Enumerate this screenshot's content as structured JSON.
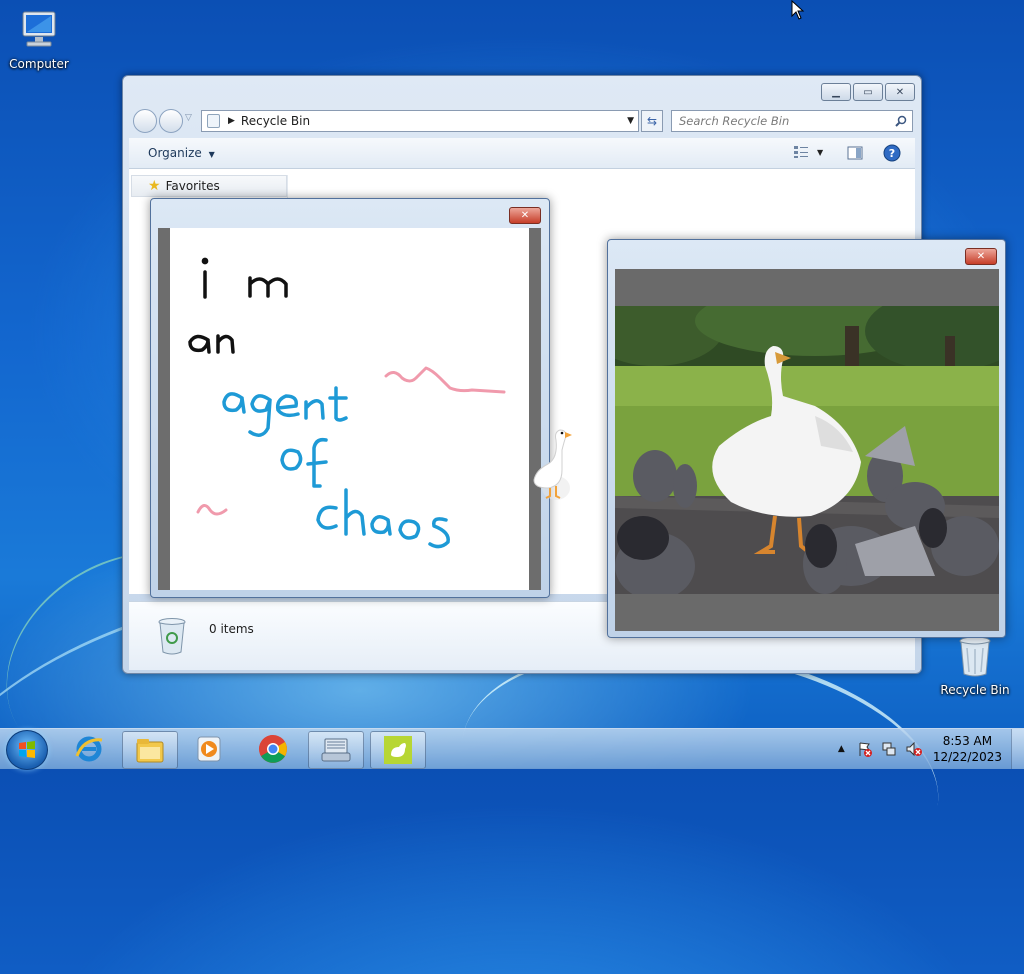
{
  "desktop": {
    "icons": [
      {
        "label": "Computer",
        "icon": "computer-icon"
      },
      {
        "label": "Recycle Bin",
        "icon": "recycle-bin-icon"
      }
    ]
  },
  "explorer": {
    "address": "Recycle Bin",
    "search_placeholder": "Search Recycle Bin",
    "organize_label": "Organize",
    "favorites_label": "Favorites",
    "item_count": "0 items"
  },
  "notepad": {
    "lines": [
      "i m",
      "an",
      "agent",
      "of",
      "chaos"
    ],
    "colors": {
      "black": "#111111",
      "blue": "#1e9ad6",
      "pink": "#f09aac"
    }
  },
  "video": {
    "subject": "goose among pigeons"
  },
  "taskbar": {
    "items": [
      "start-orb",
      "internet-explorer-icon",
      "explorer-icon",
      "media-player-icon",
      "chrome-icon",
      "keyboard-icon",
      "goose-app-icon"
    ],
    "clock_time": "8:53 AM",
    "clock_date": "12/22/2023"
  }
}
